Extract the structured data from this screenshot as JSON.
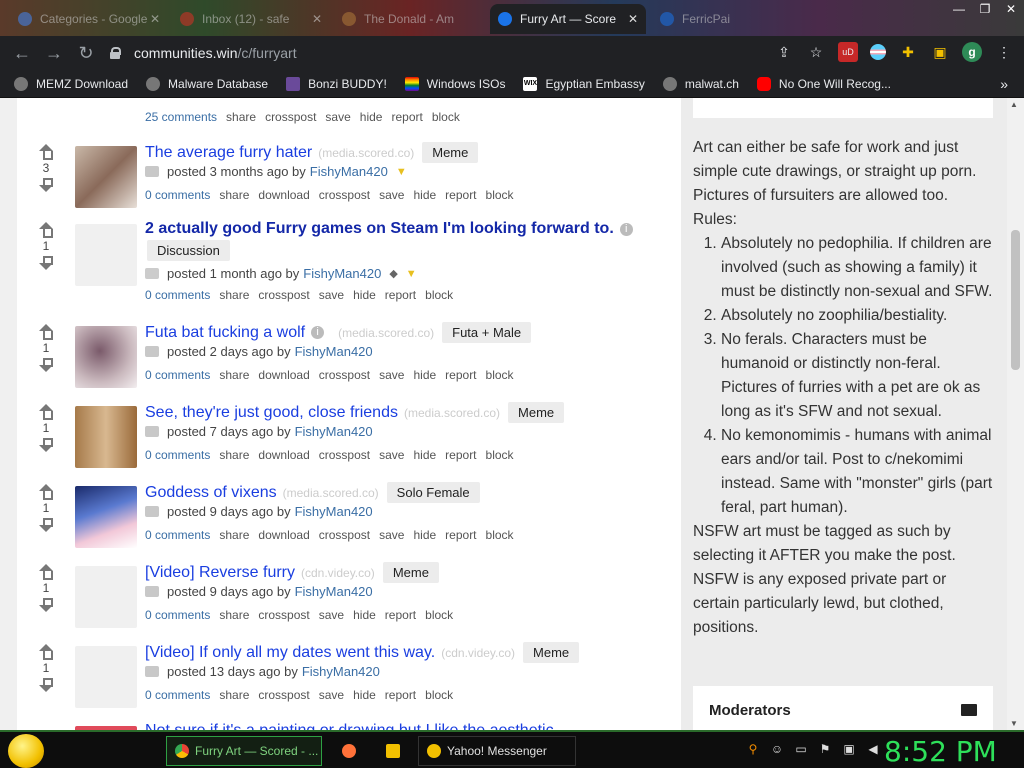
{
  "browser": {
    "tabs": [
      {
        "label": "Categories - Google",
        "active": false,
        "color": "#4285f4"
      },
      {
        "label": "Inbox (12) - safe",
        "active": false,
        "color": "#d93025"
      },
      {
        "label": "The Donald - Am",
        "active": false,
        "color": "#b07a3a"
      },
      {
        "label": "Furry Art — Score",
        "active": true,
        "color": "#1a73e8"
      },
      {
        "label": "FerricPai",
        "active": false,
        "color": "#1a73e8"
      }
    ],
    "url_host": "communities.win",
    "url_path": "/c/furryart",
    "avatar_letter": "g",
    "bookmarks": [
      {
        "label": "MEMZ Download",
        "icon": "globe-icon"
      },
      {
        "label": "Malware Database",
        "icon": "globe-icon"
      },
      {
        "label": "Bonzi BUDDY!",
        "icon": "bonzi-icon"
      },
      {
        "label": "Windows ISOs",
        "icon": "windows-icon"
      },
      {
        "label": "Egyptian Embassy",
        "icon": "wix-icon"
      },
      {
        "label": "malwat.ch",
        "icon": "globe-icon"
      },
      {
        "label": "No One Will Recog...",
        "icon": "youtube-icon"
      }
    ],
    "bookmarks_more": "»"
  },
  "feed": {
    "top_partial_actions": {
      "comments": "25 comments",
      "items": [
        "share",
        "crosspost",
        "save",
        "hide",
        "report",
        "block"
      ]
    },
    "posts": [
      {
        "score": "3",
        "title": "The average furry hater",
        "domain": "(media.scored.co)",
        "flair": "Meme",
        "posted": "posted 3 months ago by",
        "user": "FishyMan420",
        "thumb": "img",
        "pinned": true,
        "comments": "0 comments",
        "actions": [
          "share",
          "download",
          "crosspost",
          "save",
          "hide",
          "report",
          "block"
        ]
      },
      {
        "score": "1",
        "title": "2 actually good Furry games on Steam I'm looking forward to.",
        "domain": "",
        "flair": "Discussion",
        "posted": "posted 1 month ago by",
        "user": "FishyMan420",
        "thumb": "",
        "pinned": true,
        "bold": true,
        "comments": "0 comments",
        "actions": [
          "share",
          "crosspost",
          "save",
          "hide",
          "report",
          "block"
        ]
      },
      {
        "score": "1",
        "title": "Futa bat fucking a wolf",
        "domain": "(media.scored.co)",
        "flair": "Futa + Male",
        "posted": "posted 2 days ago by",
        "user": "FishyMan420",
        "thumb": "blur",
        "comments": "0 comments",
        "actions": [
          "share",
          "download",
          "crosspost",
          "save",
          "hide",
          "report",
          "block"
        ]
      },
      {
        "score": "1",
        "title": "See, they're just good, close friends",
        "domain": "(media.scored.co)",
        "flair": "Meme",
        "posted": "posted 7 days ago by",
        "user": "FishyMan420",
        "thumb": "cats",
        "comments": "0 comments",
        "actions": [
          "share",
          "download",
          "crosspost",
          "save",
          "hide",
          "report",
          "block"
        ]
      },
      {
        "score": "1",
        "title": "Goddess of vixens",
        "domain": "(media.scored.co)",
        "flair": "Solo Female",
        "posted": "posted 9 days ago by",
        "user": "FishyMan420",
        "thumb": "vix",
        "comments": "0 comments",
        "actions": [
          "share",
          "download",
          "crosspost",
          "save",
          "hide",
          "report",
          "block"
        ]
      },
      {
        "score": "1",
        "title": "[Video] Reverse furry",
        "domain": "(cdn.videy.co)",
        "flair": "Meme",
        "posted": "posted 9 days ago by",
        "user": "FishyMan420",
        "thumb": "",
        "comments": "0 comments",
        "actions": [
          "share",
          "crosspost",
          "save",
          "hide",
          "report",
          "block"
        ]
      },
      {
        "score": "1",
        "title": "[Video] If only all my dates went this way.",
        "domain": "(cdn.videy.co)",
        "flair": "Meme",
        "posted": "posted 13 days ago by",
        "user": "FishyMan420",
        "thumb": "",
        "comments": "0 comments",
        "actions": [
          "share",
          "crosspost",
          "save",
          "hide",
          "report",
          "block"
        ]
      }
    ],
    "bottom_partial_title": "Not sure if it's a painting or drawing but I like the aesthetic"
  },
  "sidebar": {
    "intro": "Art can either be safe for work and just simple cute drawings, or straight up porn. Pictures of fursuiters are allowed too.",
    "rules_label": "Rules:",
    "rules": [
      "Absolutely no pedophilia. If children are involved (such as showing a family) it must be distinctly non-sexual and SFW.",
      "Absolutely no zoophilia/bestiality.",
      "No ferals. Characters must be humanoid or distinctly non-feral. Pictures of furries with a pet are ok as long as it's SFW and not sexual.",
      "No kemonomimis - humans with animal ears and/or tail. Post to c/nekomimi instead. Same with \"monster\" girls (part feral, part human)."
    ],
    "nsfw_note": "NSFW art must be tagged as such by selecting it AFTER you make the post. NSFW is any exposed private part or certain particularly lewd, but clothed, positions.",
    "moderators_title": "Moderators"
  },
  "taskbar": {
    "items": [
      {
        "label": "Furry Art — Scored - ...",
        "active": true,
        "color": "#4285f4"
      },
      {
        "label": "",
        "active": false,
        "color": "#ff7139"
      },
      {
        "label": "",
        "active": false,
        "color": "#f2c000"
      },
      {
        "label": "Yahoo! Messenger",
        "active": false,
        "color": "#f2c000"
      }
    ],
    "clock": "8:52 PM"
  }
}
